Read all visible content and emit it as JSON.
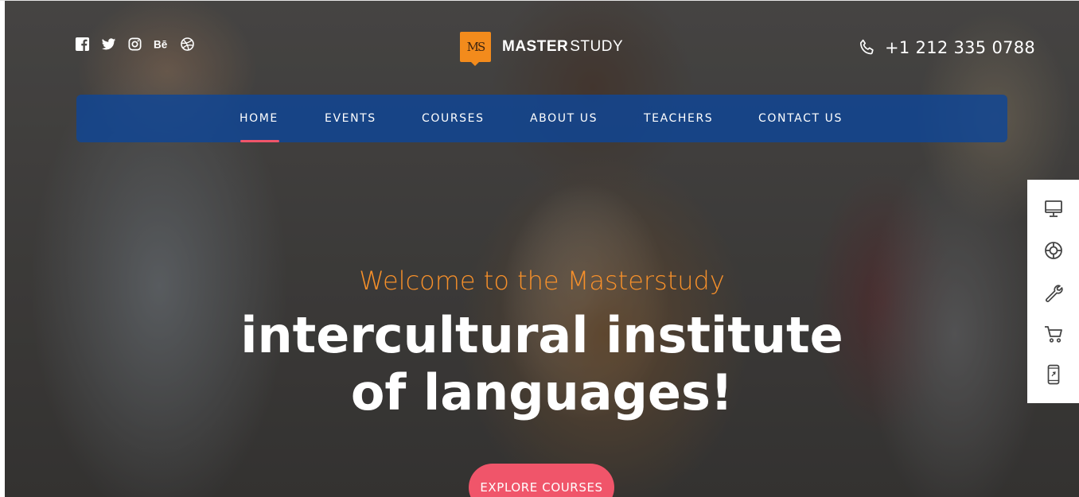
{
  "header": {
    "social_icons": [
      "facebook-icon",
      "twitter-icon",
      "instagram-icon",
      "behance-icon",
      "dribbble-icon"
    ],
    "logo": {
      "mark": "MS",
      "bold": "MASTER",
      "light": "STUDY",
      "mark_color": "#f38b1c"
    },
    "phone": "+1 212 335 0788"
  },
  "nav": {
    "items": [
      {
        "label": "HOME",
        "active": true
      },
      {
        "label": "EVENTS"
      },
      {
        "label": "COURSES"
      },
      {
        "label": "ABOUT US"
      },
      {
        "label": "TEACHERS"
      },
      {
        "label": "CONTACT US"
      }
    ],
    "background": "#0f4696",
    "active_color": "#f0556a"
  },
  "side_panel": {
    "icons": [
      "desktop-icon",
      "lifebuoy-icon",
      "wrench-icon",
      "cart-icon",
      "mobile-icon"
    ]
  },
  "hero": {
    "welcome": "Welcome to the Masterstudy",
    "headline_line1": "intercultural institute",
    "headline_line2": "of languages!",
    "cta_label": "EXPLORE COURSES",
    "accent_color": "#f7902a",
    "cta_color": "#f0556a"
  }
}
